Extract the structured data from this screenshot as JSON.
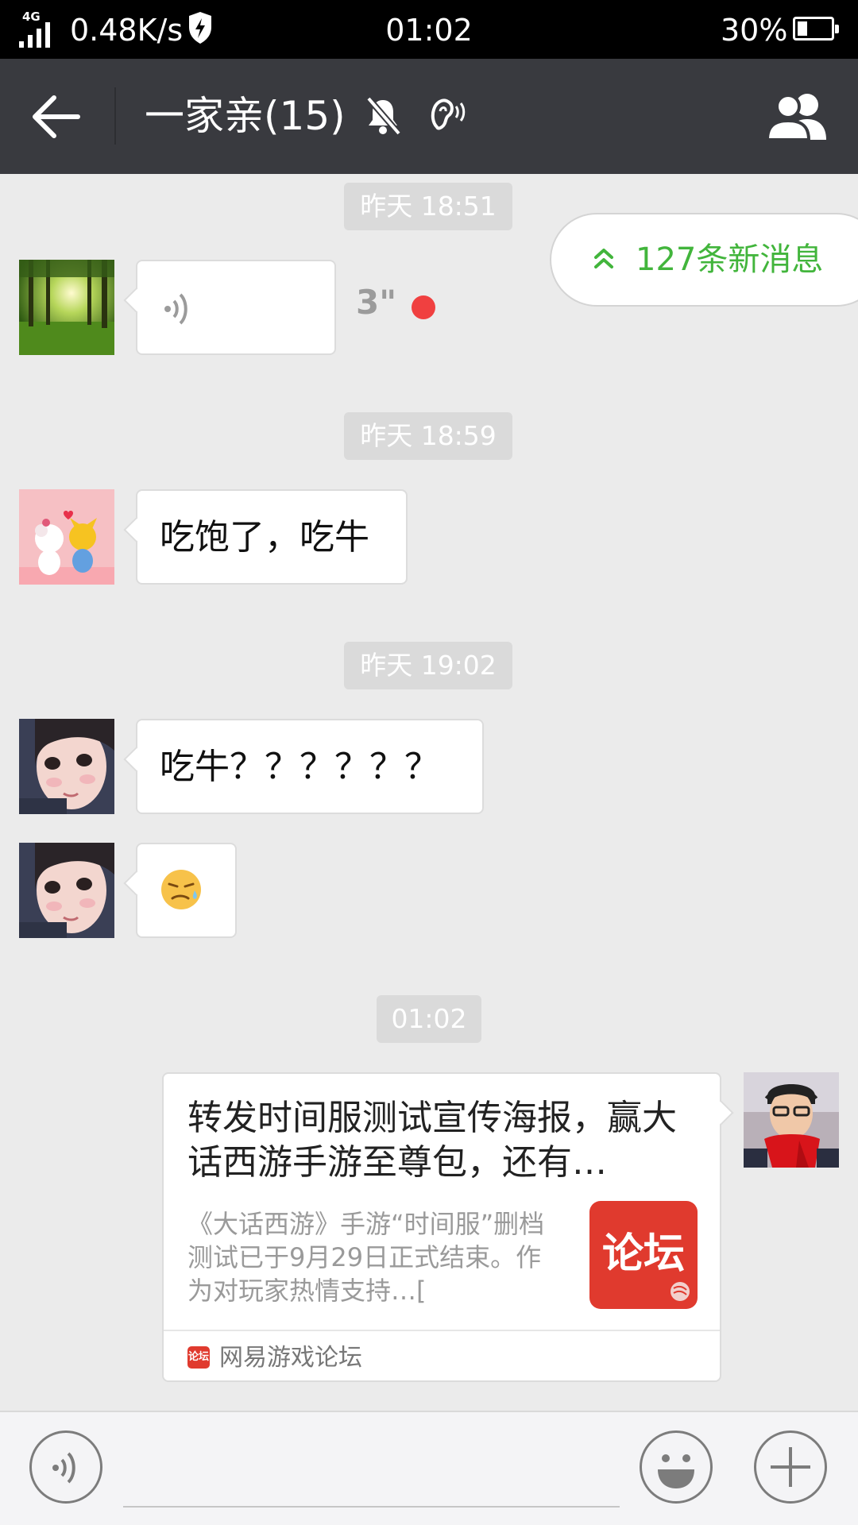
{
  "status_bar": {
    "network_type": "4G",
    "speed": "0.48K/s",
    "time": "01:02",
    "battery_percent": "30%",
    "battery_level": 0.3
  },
  "header": {
    "title": "一家亲(15)",
    "back_icon": "arrow-left-icon",
    "mute_icon": "bell-off-icon",
    "earpiece_icon": "ear-icon",
    "members_icon": "group-members-icon"
  },
  "new_messages": {
    "label": "127条新消息",
    "color": "#42b53c"
  },
  "messages": [
    {
      "timestamp": "昨天 18:51"
    },
    {
      "type": "voice",
      "side": "left",
      "duration": "3\"",
      "unread": true
    },
    {
      "timestamp": "昨天 18:59"
    },
    {
      "type": "text",
      "side": "left",
      "text": "吃饱了，吃牛"
    },
    {
      "timestamp": "昨天 19:02"
    },
    {
      "type": "text",
      "side": "left",
      "text": "吃牛？？？？？？"
    },
    {
      "type": "emoji",
      "side": "left",
      "emoji": "😓"
    },
    {
      "timestamp": "01:02"
    },
    {
      "type": "link_card",
      "side": "right",
      "title": "转发时间服测试宣传海报，赢大话西游手游至尊包，还有…",
      "description": "《大话西游》手游“时间服”删档测试已于9月29日正式结束。作为对玩家热情支持…[",
      "thumbnail_text": "论坛",
      "source": "网易游戏论坛",
      "source_icon_text": "论坛"
    }
  ],
  "input_bar": {
    "voice_icon": "voice-icon",
    "emoji_icon": "smiley-icon",
    "plus_icon": "plus-icon"
  }
}
